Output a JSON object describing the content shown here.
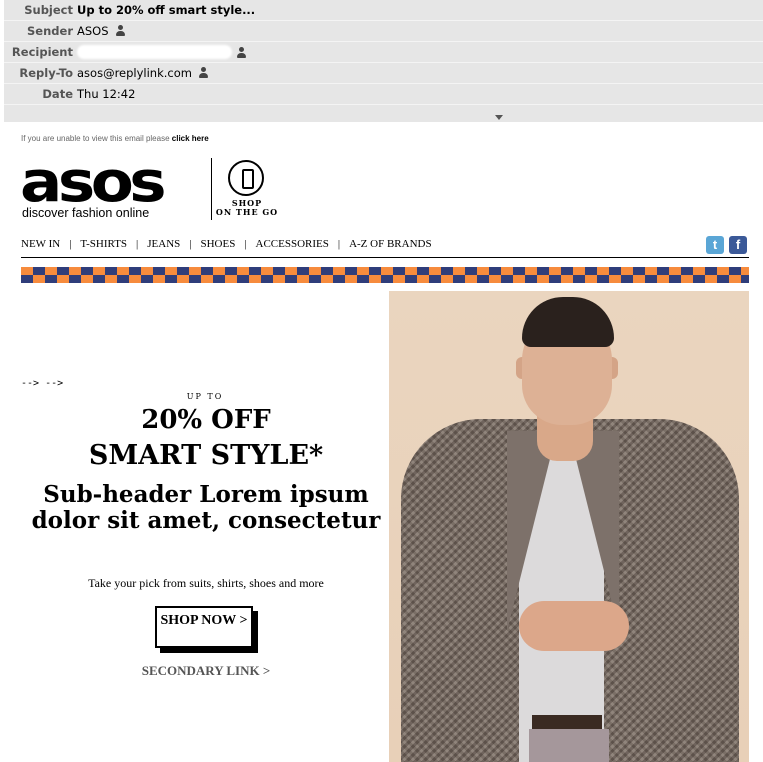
{
  "headers": [
    {
      "label": "Subject",
      "value": "Up to 20% off smart style...",
      "bold": true
    },
    {
      "label": "Sender",
      "value": "ASOS"
    },
    {
      "label": "Recipient",
      "value": ""
    },
    {
      "label": "Reply-To",
      "value": "asos@replylink.com"
    },
    {
      "label": "Date",
      "value": "Thu 12:42"
    }
  ],
  "email": {
    "view_msg": "If you are unable to view this email please",
    "view_link": "click here",
    "logo": "asos",
    "tagline": "discover fashion online",
    "shop_go_line1": "SHOP",
    "shop_go_line2": "ON THE GO",
    "nav": [
      "NEW IN",
      "T-SHIRTS",
      "JEANS",
      "SHOES",
      "ACCESSORIES",
      "A-Z OF BRANDS"
    ],
    "nav_sep": "|",
    "twitter": "t",
    "facebook": "f",
    "comment_artifact": "--> -->",
    "up_to": "UP TO",
    "headline1": "20% OFF",
    "headline2": "SMART STYLE*",
    "subheader": "Sub-header Lorem ipsum dolor sit amet, consectetur",
    "description": "Take your pick from suits, shirts, shoes and more",
    "cta": "SHOP NOW >",
    "secondary_link": "SECONDARY LINK >"
  },
  "colors": {
    "accent_orange": "#f68b3d",
    "accent_navy": "#2f3d7a",
    "header_bg": "#e6e6e6"
  }
}
